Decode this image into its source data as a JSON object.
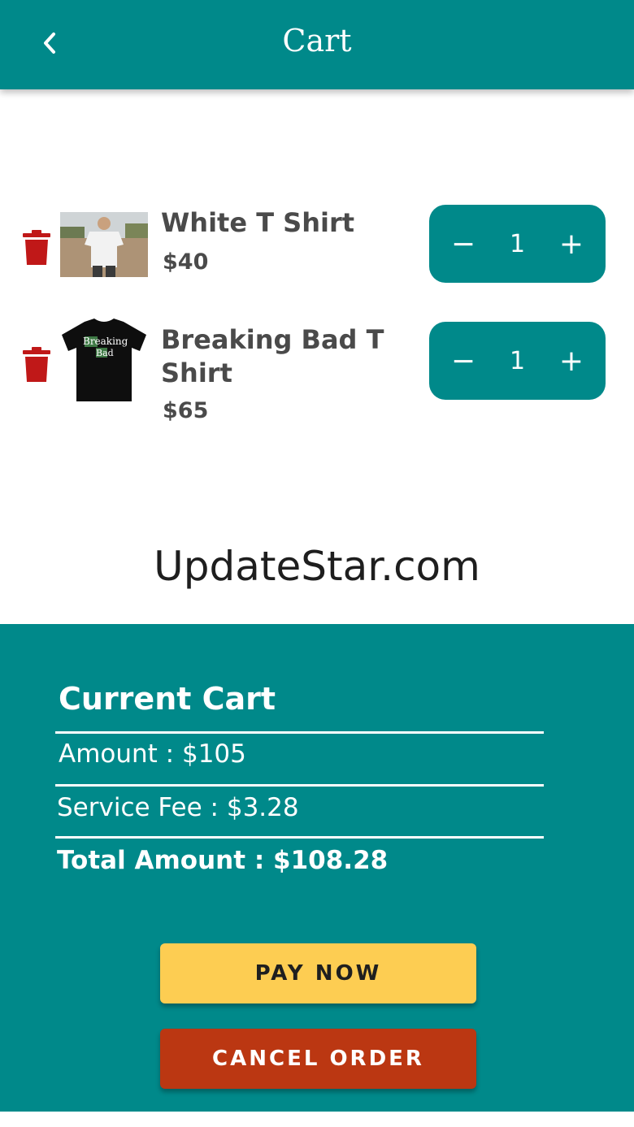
{
  "header": {
    "title": "Cart",
    "back_icon": "chevron-left-icon"
  },
  "cart": {
    "items": [
      {
        "name": "White T Shirt",
        "price": "$40",
        "quantity": "1",
        "minus": "−",
        "plus": "+",
        "image": "white-t-shirt-photo"
      },
      {
        "name": "Breaking Bad T Shirt",
        "price": "$65",
        "quantity": "1",
        "minus": "−",
        "plus": "+",
        "image": "breaking-bad-t-shirt-photo",
        "image_text_1": "Breaking",
        "image_text_2": "Bad"
      }
    ]
  },
  "watermark": "UpdateStar.com",
  "summary": {
    "title": "Current Cart",
    "amount": "Amount : $105",
    "service_fee": "Service Fee : $3.28",
    "total": "Total Amount : $108.28"
  },
  "actions": {
    "pay_label": "PAY NOW",
    "cancel_label": "CANCEL ORDER"
  },
  "colors": {
    "accent": "#00898a",
    "delete": "#c01818",
    "pay": "#fdcd52",
    "cancel": "#bb3712"
  }
}
